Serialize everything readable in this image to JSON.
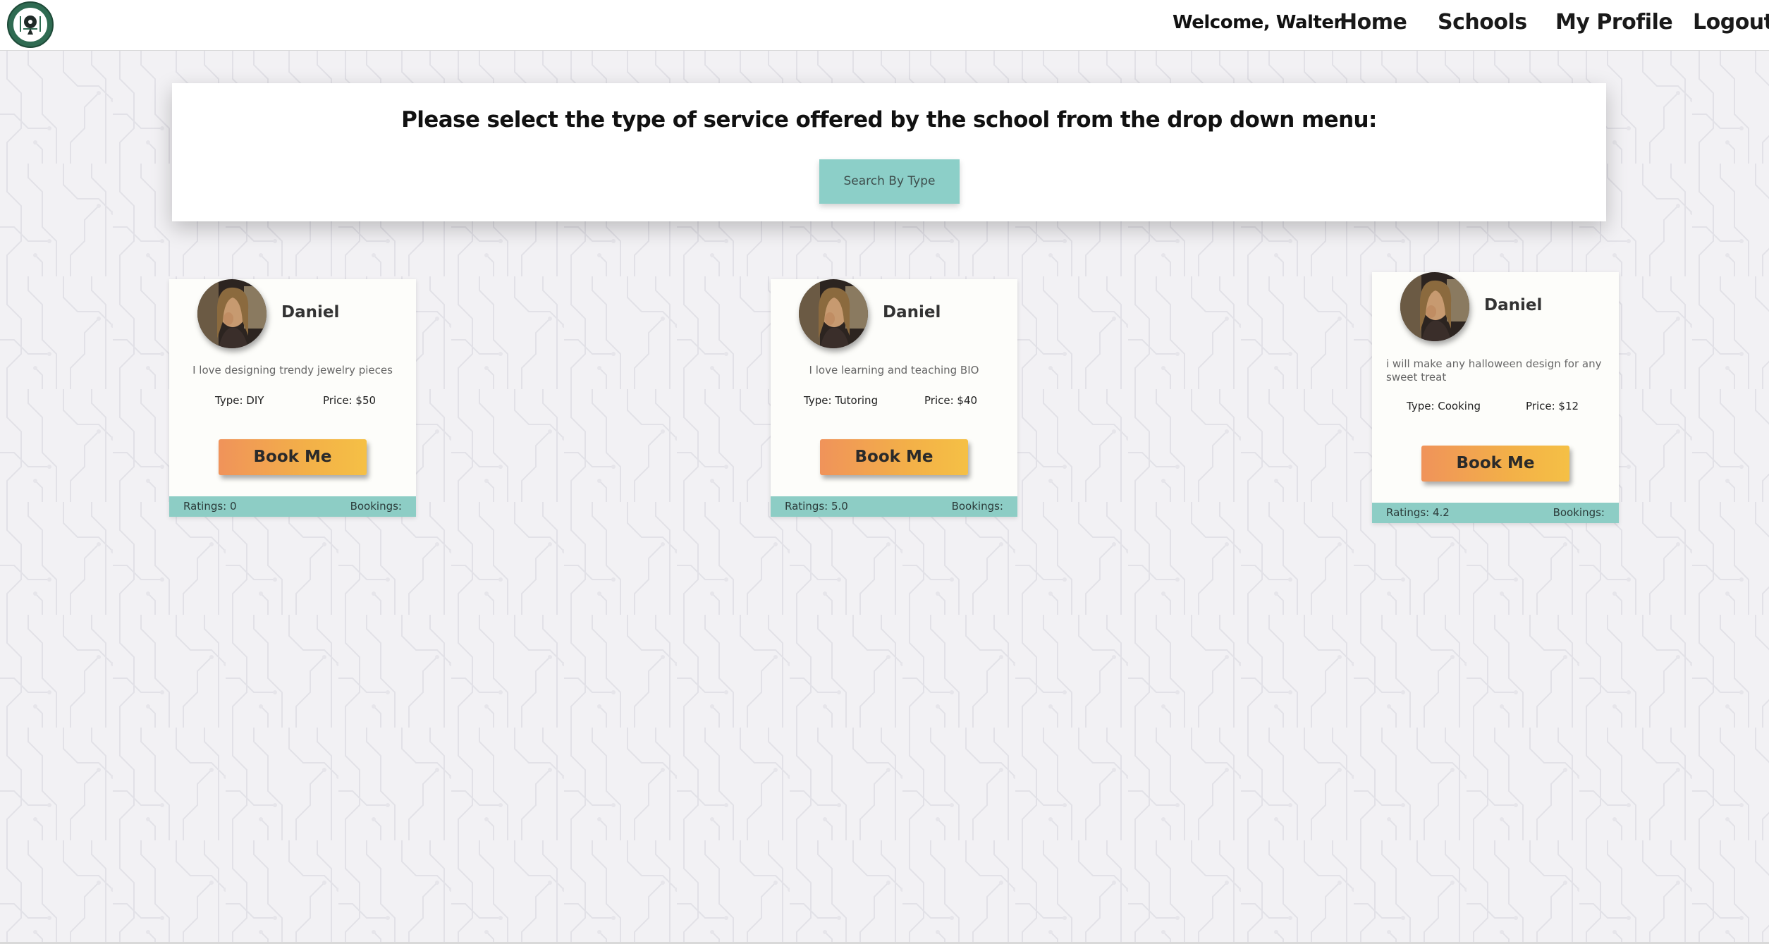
{
  "nav": {
    "welcome": "Welcome, Walter",
    "links": [
      "Home",
      "Schools",
      "My Profile",
      "Logout"
    ]
  },
  "search": {
    "title": "Please select the type of service offered by the school from the drop down menu:",
    "button_label": "Search By Type"
  },
  "colors": {
    "accent_teal": "#8dcdc5",
    "button_orange": "#f0935a",
    "button_yellow": "#f5c045"
  },
  "cards": [
    {
      "name": "Daniel",
      "description": "I love designing trendy jewelry pieces",
      "type": "Type: DIY",
      "price": "Price: $50",
      "book_label": "Book Me",
      "ratings": "Ratings: 0",
      "bookings": "Bookings:"
    },
    {
      "name": "Daniel",
      "description": "I love learning and teaching BIO",
      "type": "Type: Tutoring",
      "price": "Price: $40",
      "book_label": "Book Me",
      "ratings": "Ratings: 5.0",
      "bookings": "Bookings:"
    },
    {
      "name": "Daniel",
      "description": "i will make any halloween design for any sweet treat",
      "type": "Type: Cooking",
      "price": "Price: $12",
      "book_label": "Book Me",
      "ratings": "Ratings: 4.2",
      "bookings": "Bookings:"
    }
  ]
}
